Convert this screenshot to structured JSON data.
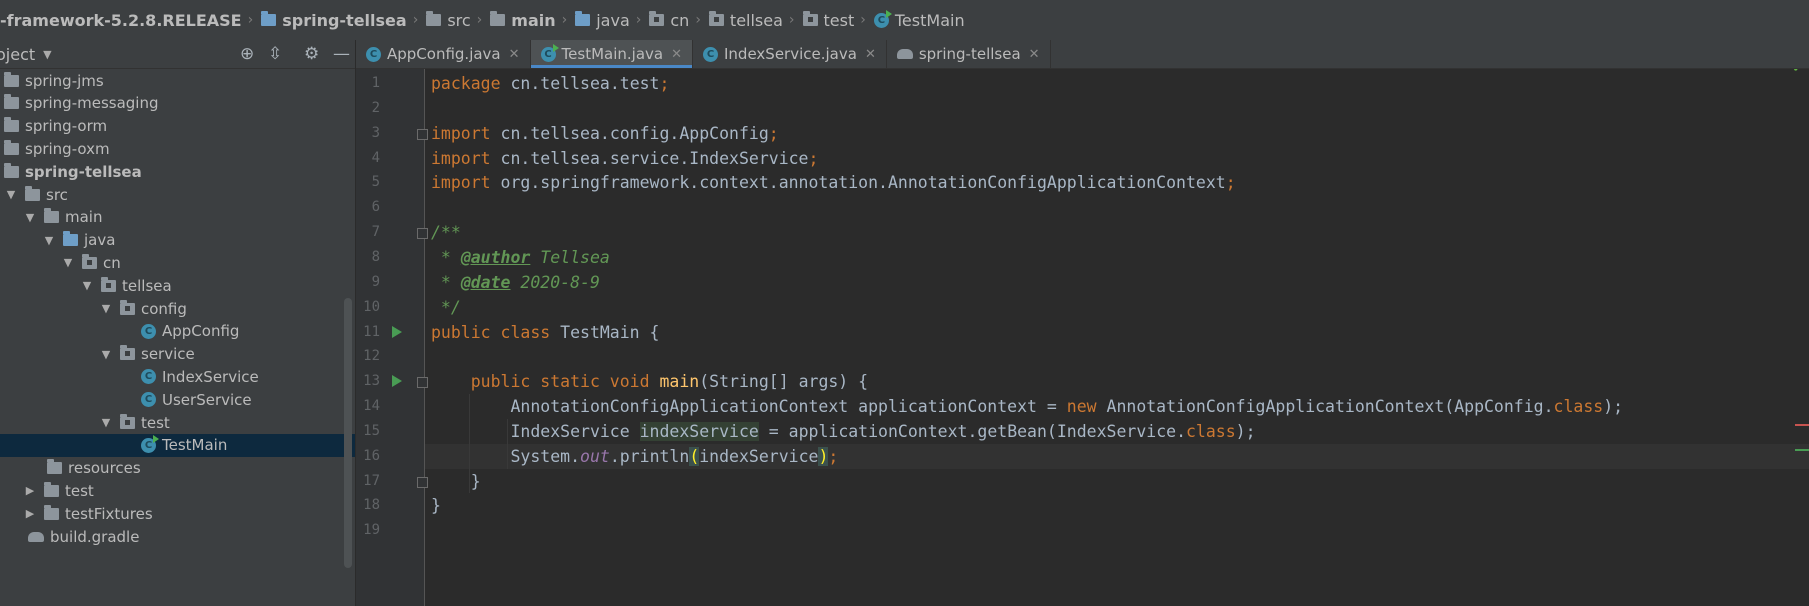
{
  "breadcrumb": {
    "items": [
      {
        "label": "-framework-5.2.8.RELEASE",
        "icon": "none",
        "bold": true
      },
      {
        "label": "spring-tellsea",
        "icon": "module-folder-icon",
        "bold": true
      },
      {
        "label": "src",
        "icon": "folder-icon",
        "bold": false
      },
      {
        "label": "main",
        "icon": "folder-icon",
        "bold": true
      },
      {
        "label": "java",
        "icon": "source-folder-icon",
        "bold": false
      },
      {
        "label": "cn",
        "icon": "package-icon",
        "bold": false
      },
      {
        "label": "tellsea",
        "icon": "package-icon",
        "bold": false
      },
      {
        "label": "test",
        "icon": "package-icon",
        "bold": false
      },
      {
        "label": "TestMain",
        "icon": "class-run-icon",
        "bold": false
      }
    ]
  },
  "project": {
    "title": "oject",
    "tree": [
      {
        "label": "spring-jms",
        "indent": 0,
        "arrow": "",
        "icon": "folder",
        "bold": false
      },
      {
        "label": "spring-messaging",
        "indent": 0,
        "arrow": "",
        "icon": "folder",
        "bold": false
      },
      {
        "label": "spring-orm",
        "indent": 0,
        "arrow": "",
        "icon": "folder",
        "bold": false
      },
      {
        "label": "spring-oxm",
        "indent": 0,
        "arrow": "",
        "icon": "folder",
        "bold": false
      },
      {
        "label": "spring-tellsea",
        "indent": 0,
        "arrow": "",
        "icon": "folder",
        "bold": true
      },
      {
        "label": "src",
        "indent": 1,
        "arrow": "expanded",
        "icon": "folder",
        "bold": false
      },
      {
        "label": "main",
        "indent": 2,
        "arrow": "expanded",
        "icon": "folder",
        "bold": false
      },
      {
        "label": "java",
        "indent": 3,
        "arrow": "expanded",
        "icon": "source-folder",
        "bold": false
      },
      {
        "label": "cn",
        "indent": 4,
        "arrow": "expanded",
        "icon": "package",
        "bold": false
      },
      {
        "label": "tellsea",
        "indent": 5,
        "arrow": "expanded",
        "icon": "package",
        "bold": false
      },
      {
        "label": "config",
        "indent": 6,
        "arrow": "expanded",
        "icon": "package",
        "bold": false
      },
      {
        "label": "AppConfig",
        "indent": 7,
        "arrow": "",
        "icon": "class",
        "bold": false
      },
      {
        "label": "service",
        "indent": 6,
        "arrow": "expanded",
        "icon": "package",
        "bold": false
      },
      {
        "label": "IndexService",
        "indent": 7,
        "arrow": "",
        "icon": "class",
        "bold": false
      },
      {
        "label": "UserService",
        "indent": 7,
        "arrow": "",
        "icon": "class",
        "bold": false
      },
      {
        "label": "test",
        "indent": 6,
        "arrow": "expanded",
        "icon": "package",
        "bold": false
      },
      {
        "label": "TestMain",
        "indent": 7,
        "arrow": "",
        "icon": "class-run",
        "bold": false,
        "selected": true
      },
      {
        "label": "resources",
        "indent": 3,
        "arrow": "",
        "icon": "folder",
        "bold": false
      },
      {
        "label": "test",
        "indent": 2,
        "arrow": "collapsed",
        "icon": "folder",
        "bold": false
      },
      {
        "label": "testFixtures",
        "indent": 2,
        "arrow": "collapsed",
        "icon": "folder",
        "bold": false
      },
      {
        "label": "build.gradle",
        "indent": 2,
        "arrow": "",
        "icon": "gradle",
        "bold": false
      }
    ]
  },
  "tabs": [
    {
      "label": "AppConfig.java",
      "icon": "class-icon",
      "active": false
    },
    {
      "label": "TestMain.java",
      "icon": "class-run-icon",
      "active": true
    },
    {
      "label": "IndexService.java",
      "icon": "class-icon",
      "active": false
    },
    {
      "label": "spring-tellsea",
      "icon": "gradle-icon",
      "active": false
    }
  ],
  "editor": {
    "current_line": 16,
    "run_gutter_lines": [
      11,
      13
    ],
    "fold_lines": [
      3,
      7,
      13,
      17
    ],
    "lines": [
      {
        "n": "1",
        "tokens": [
          {
            "t": "package ",
            "c": "kw"
          },
          {
            "t": "cn.tellsea.test",
            "c": ""
          },
          {
            "t": ";",
            "c": "kw"
          }
        ]
      },
      {
        "n": "2",
        "tokens": []
      },
      {
        "n": "3",
        "tokens": [
          {
            "t": "import ",
            "c": "kw"
          },
          {
            "t": "cn.tellsea.config.AppConfig",
            "c": ""
          },
          {
            "t": ";",
            "c": "kw"
          }
        ]
      },
      {
        "n": "4",
        "tokens": [
          {
            "t": "import ",
            "c": "kw"
          },
          {
            "t": "cn.tellsea.service.IndexService",
            "c": ""
          },
          {
            "t": ";",
            "c": "kw"
          }
        ]
      },
      {
        "n": "5",
        "tokens": [
          {
            "t": "import ",
            "c": "kw"
          },
          {
            "t": "org.springframework.context.annotation.AnnotationConfigApplicationContext",
            "c": ""
          },
          {
            "t": ";",
            "c": "kw"
          }
        ]
      },
      {
        "n": "6",
        "tokens": []
      },
      {
        "n": "7",
        "tokens": [
          {
            "t": "/**",
            "c": "cm"
          }
        ]
      },
      {
        "n": "8",
        "tokens": [
          {
            "t": " * ",
            "c": "cm"
          },
          {
            "t": "@author",
            "c": "tag"
          },
          {
            "t": " Tellsea",
            "c": "cm"
          }
        ]
      },
      {
        "n": "9",
        "tokens": [
          {
            "t": " * ",
            "c": "cm"
          },
          {
            "t": "@date",
            "c": "tag"
          },
          {
            "t": " 2020-8-9",
            "c": "cm"
          }
        ]
      },
      {
        "n": "10",
        "tokens": [
          {
            "t": " */",
            "c": "cm"
          }
        ]
      },
      {
        "n": "11",
        "tokens": [
          {
            "t": "public class ",
            "c": "kw"
          },
          {
            "t": "TestMain {",
            "c": ""
          }
        ]
      },
      {
        "n": "12",
        "tokens": []
      },
      {
        "n": "13",
        "tokens": [
          {
            "t": "    public static void ",
            "c": "kw"
          },
          {
            "t": "main",
            "c": "fn"
          },
          {
            "t": "(String[] args) {",
            "c": ""
          }
        ]
      },
      {
        "n": "14",
        "tokens": [
          {
            "t": "        AnnotationConfigApplicationContext applicationContext = ",
            "c": ""
          },
          {
            "t": "new ",
            "c": "kw"
          },
          {
            "t": "AnnotationConfigApplicationContext(AppConfig.",
            "c": ""
          },
          {
            "t": "class",
            "c": "kw"
          },
          {
            "t": ");",
            "c": ""
          }
        ]
      },
      {
        "n": "15",
        "tokens": [
          {
            "t": "        IndexService ",
            "c": ""
          },
          {
            "t": "indexService",
            "c": "hlvar"
          },
          {
            "t": " = applicationContext.getBean(IndexService.",
            "c": ""
          },
          {
            "t": "class",
            "c": "kw"
          },
          {
            "t": ");",
            "c": ""
          }
        ]
      },
      {
        "n": "16",
        "tokens": [
          {
            "t": "        System.",
            "c": ""
          },
          {
            "t": "out",
            "c": "st"
          },
          {
            "t": ".println",
            "c": ""
          },
          {
            "t": "(",
            "c": "paren"
          },
          {
            "t": "indexService",
            "c": ""
          },
          {
            "t": ")",
            "c": "paren"
          },
          {
            "t": ";",
            "c": "kw"
          }
        ]
      },
      {
        "n": "17",
        "tokens": [
          {
            "t": "    }",
            "c": ""
          }
        ]
      },
      {
        "n": "18",
        "tokens": [
          {
            "t": "}",
            "c": ""
          }
        ]
      },
      {
        "n": "19",
        "tokens": []
      }
    ]
  },
  "colors": {
    "keyword": "#cc7832",
    "comment": "#629755",
    "method": "#ffc66d",
    "static_field": "#9876aa",
    "default_text": "#a9b7c6",
    "background": "#2b2b2b",
    "panel": "#3c3f41",
    "selection": "#0d293e",
    "accent": "#4a88c7"
  }
}
